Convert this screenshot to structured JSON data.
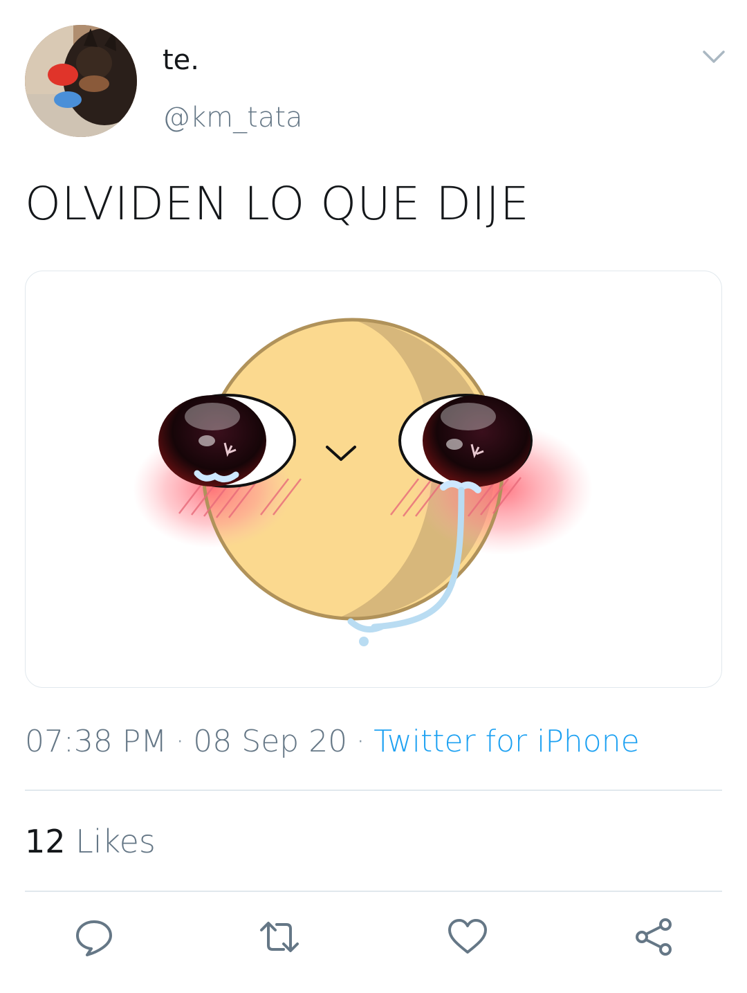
{
  "author": {
    "display_name": "te.",
    "handle": "@km_tata"
  },
  "tweet": {
    "text": "OLVIDEN LO QUE DIJE",
    "time": "07:38 PM",
    "separator": "·",
    "date": "08 Sep 20",
    "source": "Twitter for iPhone"
  },
  "stats": {
    "likes_count": "12",
    "likes_label": "Likes"
  },
  "icons": {
    "menu": "chevron-down-icon",
    "reply": "reply-icon",
    "retweet": "retweet-icon",
    "like": "heart-icon",
    "share": "share-icon"
  },
  "colors": {
    "link": "#1da1f2",
    "secondary_text": "#657786",
    "icon": "#657786",
    "divider": "#e1e8ed"
  }
}
